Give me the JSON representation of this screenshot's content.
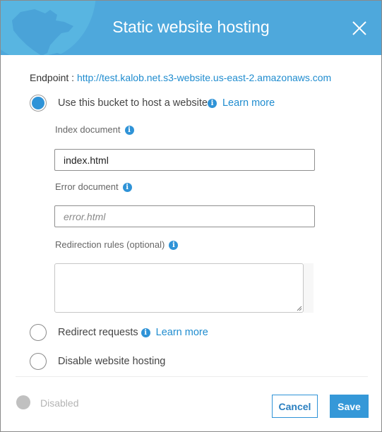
{
  "dialog": {
    "title": "Static website hosting",
    "close_icon": "close-icon",
    "header_color": "#4ea8dc",
    "accent_color": "#2f93d7"
  },
  "endpoint": {
    "label": "Endpoint : ",
    "url": "http://test.kalob.net.s3-website.us-east-2.amazonaws.com"
  },
  "options": [
    {
      "label": "Use this bucket to host a website",
      "selected": true,
      "learn_more": "Learn more",
      "info_icon": "info-icon"
    },
    {
      "label": "Redirect requests",
      "selected": false,
      "learn_more": "Learn more",
      "info_icon": "info-icon"
    },
    {
      "label": "Disable website hosting",
      "selected": false
    }
  ],
  "fields": {
    "index_document": {
      "label": "Index document",
      "value": "index.html"
    },
    "error_document": {
      "label": "Error document",
      "value": "",
      "placeholder": "error.html"
    },
    "redirection_rules": {
      "label": "Redirection rules (optional)",
      "value": ""
    }
  },
  "footer": {
    "status_label": "Disabled",
    "cancel_label": "Cancel",
    "save_label": "Save"
  }
}
